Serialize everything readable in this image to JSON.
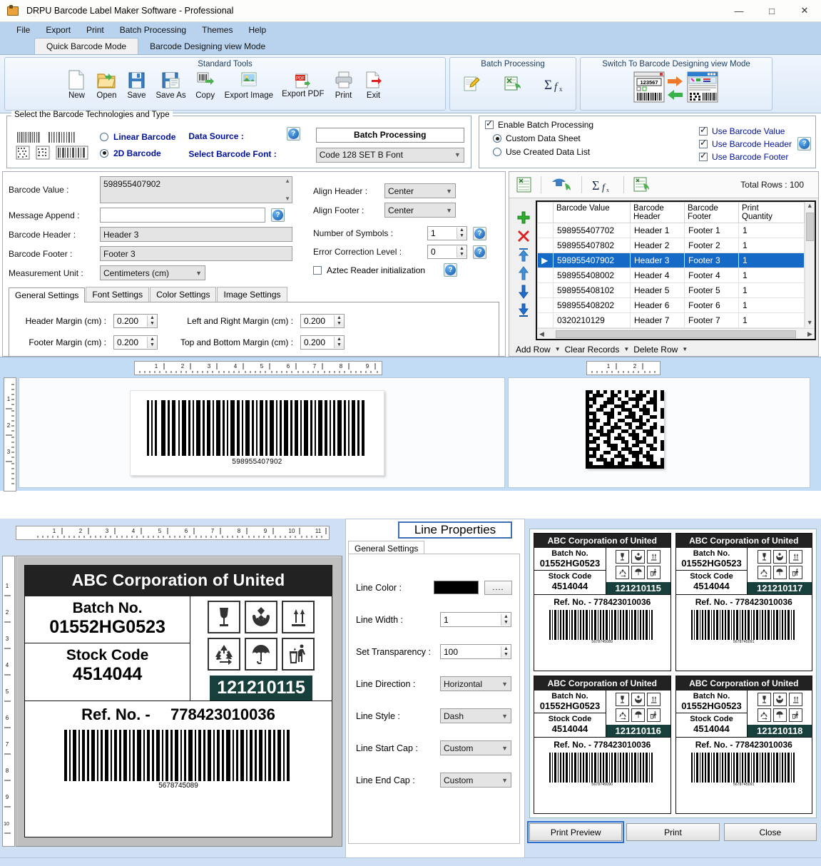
{
  "window": {
    "title": "DRPU Barcode Label Maker Software - Professional",
    "app_icon": "barcode-app-icon",
    "minimize": "—",
    "maximize": "□",
    "close": "✕"
  },
  "menu": {
    "items": [
      "File",
      "Export",
      "Print",
      "Batch Processing",
      "Themes",
      "Help"
    ]
  },
  "mode_tabs": [
    {
      "label": "Quick Barcode Mode",
      "active": true
    },
    {
      "label": "Barcode Designing view Mode",
      "active": false
    }
  ],
  "ribbon": {
    "groups": [
      {
        "title": "Standard Tools",
        "items": [
          {
            "label": "New",
            "icon": "new-document-icon"
          },
          {
            "label": "Open",
            "icon": "open-folder-icon"
          },
          {
            "label": "Save",
            "icon": "floppy-save-icon"
          },
          {
            "label": "Save As",
            "icon": "floppy-save-as-icon"
          },
          {
            "label": "Copy",
            "icon": "copy-barcode-icon"
          },
          {
            "label": "Export Image",
            "icon": "export-image-icon"
          },
          {
            "label": "Export PDF",
            "icon": "export-pdf-icon"
          },
          {
            "label": "Print",
            "icon": "printer-icon"
          },
          {
            "label": "Exit",
            "icon": "exit-arrow-icon"
          }
        ]
      },
      {
        "title": "Batch Processing",
        "items": [
          {
            "label": "",
            "icon": "edit-sheet-icon"
          },
          {
            "label": "",
            "icon": "import-sheet-icon"
          },
          {
            "label": "",
            "icon": "sum-function-icon"
          }
        ]
      },
      {
        "title": "Switch To Barcode Designing view Mode",
        "items": [
          {
            "label": "",
            "icon": "switch-mode-icon"
          }
        ]
      }
    ]
  },
  "tech_panel": {
    "legend": "Select the Barcode Technologies and Type",
    "icons": [
      "linear-barcode-sample-icon",
      "linear-barcode-sample2-icon",
      "datamatrix-sample-icon",
      "qr-sample-icon",
      "pdf417-sample-icon"
    ],
    "linear_label": "Linear Barcode",
    "twod_label": "2D Barcode",
    "selected_type": "2D Barcode",
    "data_source_label": "Data Source :",
    "select_font_label": "Select Barcode Font :",
    "batch_processing_button": "Batch Processing",
    "barcode_font_value": "Code 128 SET B Font",
    "help_icon": "help-icon"
  },
  "batch_panel": {
    "enable_label": "Enable Batch Processing",
    "enable_checked": true,
    "custom_data_sheet": "Custom Data Sheet",
    "use_created_data_list": "Use Created Data List",
    "selected_source": "Custom Data Sheet",
    "use_barcode_value": "Use Barcode Value",
    "use_barcode_header": "Use Barcode Header",
    "use_barcode_footer": "Use Barcode Footer",
    "value_checked": true,
    "header_checked": true,
    "footer_checked": true,
    "help_icon": "help-icon"
  },
  "properties": {
    "barcode_value_label": "Barcode Value :",
    "barcode_value": "598955407902",
    "message_append_label": "Message Append :",
    "message_append": "",
    "barcode_header_label": "Barcode Header :",
    "barcode_header": "Header 3",
    "barcode_footer_label": "Barcode Footer :",
    "barcode_footer": "Footer 3",
    "measurement_unit_label": "Measurement Unit :",
    "measurement_unit": "Centimeters (cm)",
    "align_header_label": "Align Header :",
    "align_header": "Center",
    "align_footer_label": "Align Footer :",
    "align_footer": "Center",
    "number_of_symbols_label": "Number of Symbols :",
    "number_of_symbols": "1",
    "error_correction_label": "Error Correction Level :",
    "error_correction": "0",
    "aztec_label": "Aztec Reader initialization",
    "aztec_checked": false,
    "tabs": [
      "General Settings",
      "Font Settings",
      "Color Settings",
      "Image Settings"
    ],
    "active_tab": "General Settings",
    "header_margin_label": "Header Margin (cm) :",
    "header_margin": "0.200",
    "footer_margin_label": "Footer Margin (cm) :",
    "footer_margin": "0.200",
    "lr_margin_label": "Left  and Right Margin (cm) :",
    "lr_margin": "0.200",
    "tb_margin_label": "Top and Bottom Margin (cm) :",
    "tb_margin": "0.200"
  },
  "datagrid": {
    "toolbar_icons": [
      "new-sheet-icon",
      "import-data-icon",
      "sum-function-icon",
      "export-sheet-icon"
    ],
    "total_rows_label": "Total Rows : 100",
    "row_buttons": [
      "add-row-icon",
      "delete-row-icon",
      "move-top-icon",
      "move-up-icon",
      "move-down-icon",
      "move-bottom-icon"
    ],
    "columns": [
      "",
      "Barcode Value",
      "Barcode\nHeader",
      "Barcode\nFooter",
      "Print\nQuantity"
    ],
    "column_headers": [
      "Barcode Value",
      "Barcode Header",
      "Barcode Footer",
      "Print Quantity"
    ],
    "rows": [
      {
        "value": "598955407702",
        "header": "Header 1",
        "footer": "Footer 1",
        "qty": "1",
        "selected": false
      },
      {
        "value": "598955407802",
        "header": "Header 2",
        "footer": "Footer 2",
        "qty": "1",
        "selected": false
      },
      {
        "value": "598955407902",
        "header": "Header 3",
        "footer": "Footer 3",
        "qty": "1",
        "selected": true
      },
      {
        "value": "598955408002",
        "header": "Header 4",
        "footer": "Footer 4",
        "qty": "1",
        "selected": false
      },
      {
        "value": "598955408102",
        "header": "Header 5",
        "footer": "Footer 5",
        "qty": "1",
        "selected": false
      },
      {
        "value": "598955408202",
        "header": "Header 6",
        "footer": "Footer 6",
        "qty": "1",
        "selected": false
      },
      {
        "value": "0320210129",
        "header": "Header 7",
        "footer": "Footer 7",
        "qty": "1",
        "selected": false
      }
    ],
    "footer_buttons": [
      "Add Row",
      "Clear Records",
      "Delete Row"
    ]
  },
  "preview": {
    "linear_ruler_ticks": [
      "1",
      "2",
      "3",
      "4",
      "5",
      "6",
      "7",
      "8",
      "9"
    ],
    "linear_vruler_ticks": [
      "1",
      "2",
      "3"
    ],
    "twod_ruler_ticks": [
      "1",
      "2"
    ],
    "linear_barcode_text": "598955407902",
    "twod_icon": "datamatrix-barcode"
  },
  "designer": {
    "ruler_ticks": [
      "1",
      "2",
      "3",
      "4",
      "5",
      "6",
      "7",
      "8",
      "9",
      "10",
      "11"
    ],
    "vruler_ticks": [
      "1",
      "2",
      "3",
      "4",
      "5",
      "6",
      "7",
      "8",
      "9",
      "10"
    ],
    "label": {
      "title": "ABC Corporation of United",
      "batch_label": "Batch No.",
      "batch_value": "01552HG0523",
      "stock_label": "Stock Code",
      "stock_value": "4514044",
      "green_code": "121210115",
      "ref_label": "Ref. No. -",
      "ref_value": "778423010036",
      "barcode_number": "5678745089",
      "pictograms": [
        "fragile-glass-icon",
        "handle-with-care-icon",
        "this-way-up-icon",
        "recycle-icon",
        "keep-dry-umbrella-icon",
        "do-not-litter-icon"
      ]
    }
  },
  "line_properties": {
    "title": "Line Properties",
    "tab": "General Settings",
    "line_color_label": "Line Color :",
    "line_color": "#000000",
    "color_picker_button": "....",
    "line_width_label": "Line Width :",
    "line_width": "1",
    "transparency_label": "Set Transparency :",
    "transparency": "100",
    "direction_label": "Line Direction :",
    "direction": "Horizontal",
    "style_label": "Line Style :",
    "style": "Dash",
    "start_cap_label": "Line Start Cap :",
    "start_cap": "Custom",
    "end_cap_label": "Line End Cap :",
    "end_cap": "Custom"
  },
  "print_preview": {
    "labels": [
      {
        "title": "ABC Corporation of United",
        "batch_label": "Batch No.",
        "batch_value": "01552HG0523",
        "stock_label": "Stock Code",
        "stock_value": "4514044",
        "green_code": "121210115",
        "ref_label": "Ref. No. -",
        "ref_value": "778423010036",
        "barcode_number": "5678745089"
      },
      {
        "title": "ABC Corporation of United",
        "batch_label": "Batch No.",
        "batch_value": "01552HG0523",
        "stock_label": "Stock Code",
        "stock_value": "4514044",
        "green_code": "121210117",
        "ref_label": "Ref. No. -",
        "ref_value": "778423010036",
        "barcode_number": "5678745091"
      },
      {
        "title": "ABC Corporation of United",
        "batch_label": "Batch No.",
        "batch_value": "01552HG0523",
        "stock_label": "Stock Code",
        "stock_value": "4514044",
        "green_code": "121210116",
        "ref_label": "Ref. No. -",
        "ref_value": "778423010036",
        "barcode_number": "5678745090"
      },
      {
        "title": "ABC Corporation of United",
        "batch_label": "Batch No.",
        "batch_value": "01552HG0523",
        "stock_label": "Stock Code",
        "stock_value": "4514044",
        "green_code": "121210118",
        "ref_label": "Ref. No. -",
        "ref_value": "778423010036",
        "barcode_number": "5678745091"
      }
    ],
    "buttons": [
      {
        "label": "Print Preview",
        "focused": true
      },
      {
        "label": "Print",
        "focused": false
      },
      {
        "label": "Close",
        "focused": false
      }
    ]
  },
  "colors": {
    "accent_blue": "#1569c7",
    "menu_blue": "#b9d3ef",
    "panel_blue": "#cfe0f4",
    "label_dark": "#222222",
    "green_badge": "#17403c",
    "link_blue": "#00119c"
  }
}
